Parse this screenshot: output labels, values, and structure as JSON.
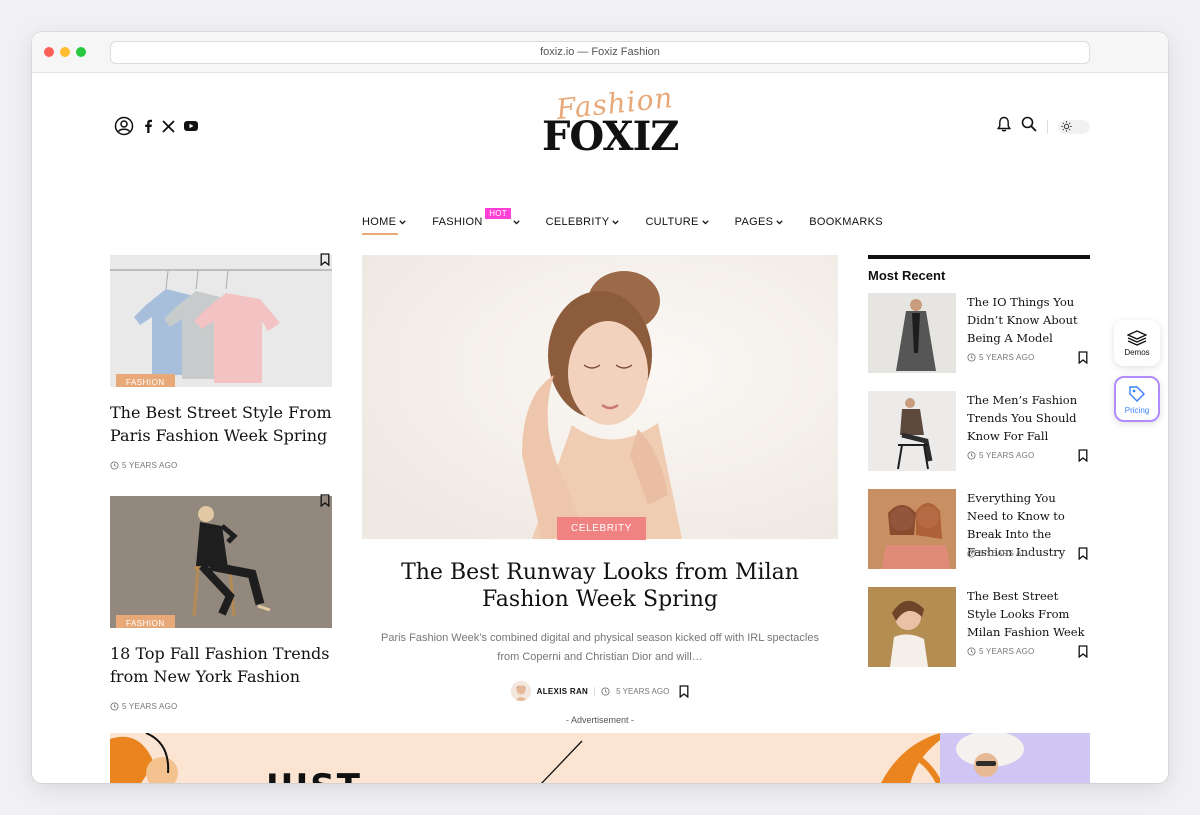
{
  "browser": {
    "url_title": "foxiz.io — Foxiz Fashion"
  },
  "logo": {
    "script": "Fashion",
    "main": "FOXIZ"
  },
  "nav": {
    "items": [
      {
        "label": "HOME"
      },
      {
        "label": "FASHION"
      },
      {
        "label": "CELEBRITY"
      },
      {
        "label": "CULTURE"
      },
      {
        "label": "PAGES"
      },
      {
        "label": "BOOKMARKS"
      }
    ],
    "hot_badge": "HOT"
  },
  "left_cards": [
    {
      "category": "FASHION",
      "title": "The Best Street Style From Paris Fashion Week Spring",
      "time": "5 YEARS AGO"
    },
    {
      "category": "FASHION",
      "title": "18 Top Fall Fashion Trends from New York Fashion",
      "time": "5 YEARS AGO"
    }
  ],
  "feature": {
    "category": "CELEBRITY",
    "title": "The Best Runway Looks from Milan Fashion Week Spring",
    "excerpt": "Paris Fashion Week’s combined digital and physical season kicked off with IRL spectacles from Coperni and Christian Dior and will…",
    "author": "ALEXIS RAN",
    "time": "5 YEARS AGO"
  },
  "recent": {
    "heading": "Most Recent",
    "items": [
      {
        "title": "The IO Things You Didn’t Know About Being A Model",
        "time": "5 YEARS AGO"
      },
      {
        "title": "The Men’s Fashion Trends You Should Know For Fall",
        "time": "5 YEARS AGO"
      },
      {
        "title": "Everything You Need to Know to Break Into the Fashion Industry",
        "time": "5 YEARS AGO"
      },
      {
        "title": "The Best Street Style Looks From Milan Fashion Week",
        "time": "5 YEARS AGO"
      }
    ]
  },
  "floating": {
    "demos": "Demos",
    "pricing": "Pricing"
  },
  "ad": {
    "label": "- Advertisement -",
    "text": "JUST"
  },
  "colors": {
    "accent": "#e8a878",
    "hot": "#ff3fd6",
    "celebrity": "#f08282"
  }
}
